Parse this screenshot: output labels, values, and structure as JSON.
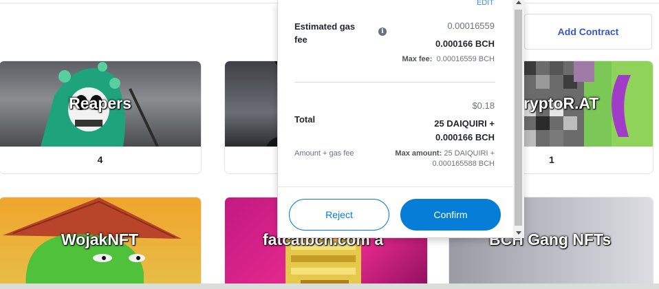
{
  "header": {
    "add_contract_label": "Add Contract"
  },
  "collections": [
    {
      "name": "Reapers",
      "count": "4"
    },
    {
      "name": "",
      "count": ""
    },
    {
      "name": "ryptoR.AT",
      "count": "1"
    },
    {
      "name": "WojakNFT"
    },
    {
      "name": "fatcatbch.com a"
    },
    {
      "name": "BCH Gang NFTs"
    }
  ],
  "modal": {
    "edit_label": "EDIT",
    "gas": {
      "label": "Estimated gas fee",
      "info_icon": "info-icon",
      "value_secondary": "0.00016559",
      "value_primary": "0.000166 BCH",
      "max_fee_label": "Max fee:",
      "max_fee_value": "0.00016559 BCH"
    },
    "total": {
      "label": "Total",
      "fiat": "$0.18",
      "line1": "25 DAIQUIRI +",
      "line2": "0.000166 BCH",
      "sub_label": "Amount + gas fee",
      "max_amount_label": "Max amount:",
      "max_amount_value_line1": "25 DAIQUIRI +",
      "max_amount_value_line2": "0.000165588 BCH"
    },
    "buttons": {
      "reject": "Reject",
      "confirm": "Confirm"
    }
  },
  "colors": {
    "primary": "#037dd6",
    "link": "#3557c8",
    "text": "#24272a",
    "muted": "#6a737d"
  }
}
